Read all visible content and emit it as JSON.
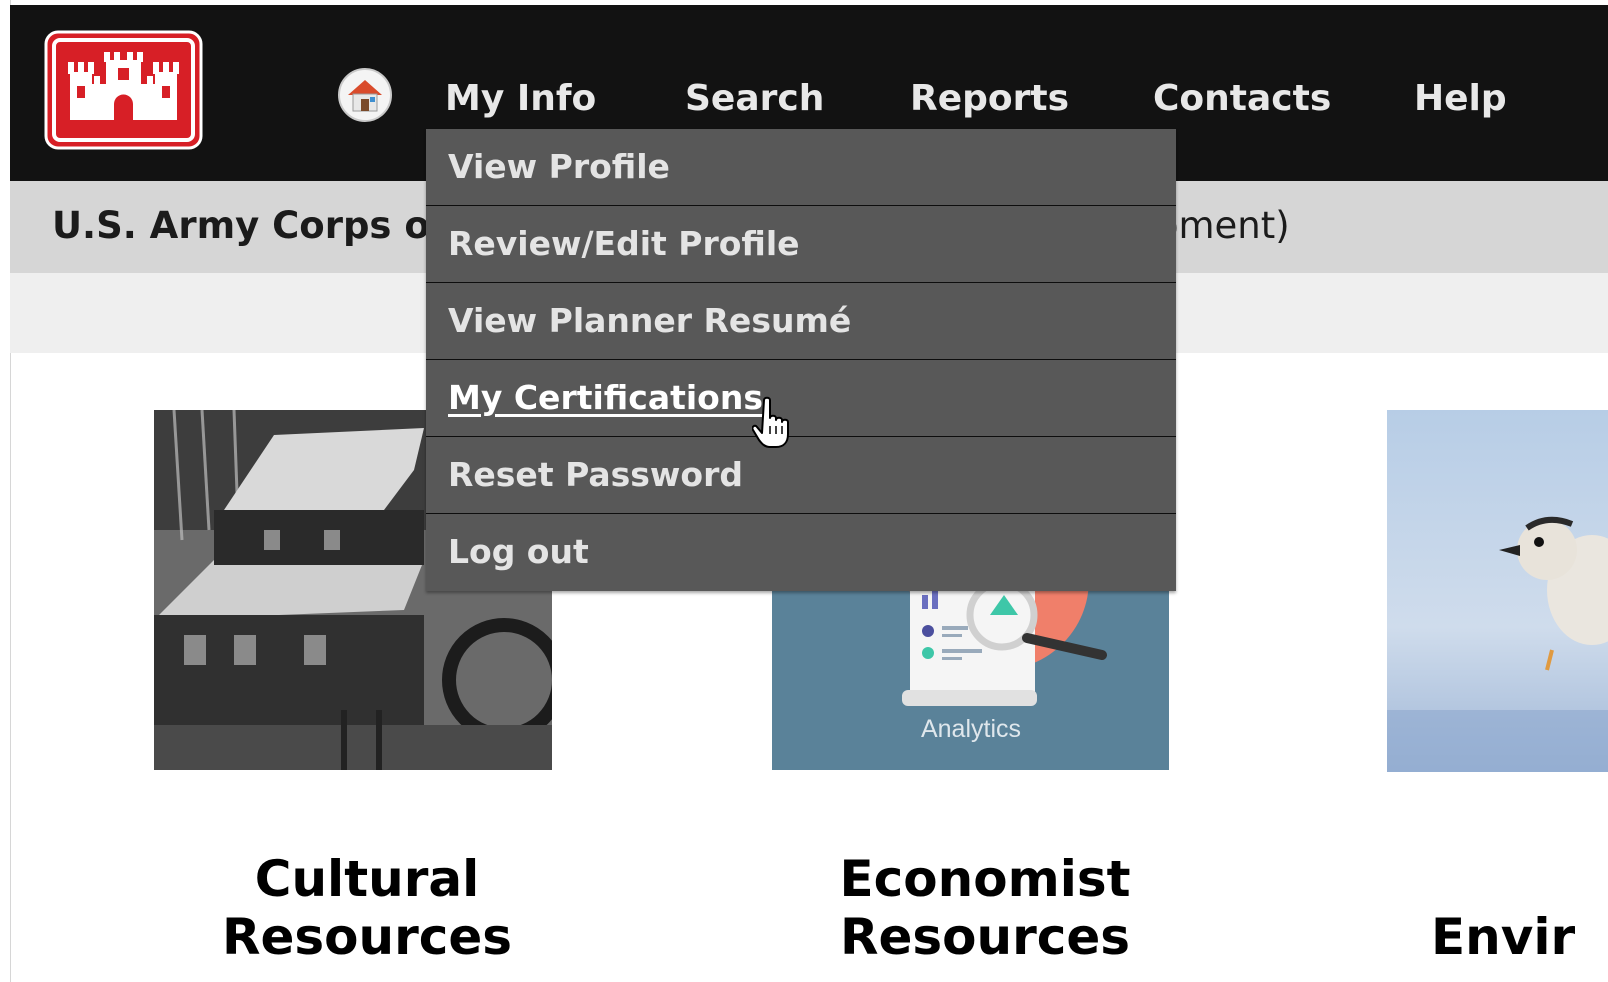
{
  "header": {
    "logo_name": "castle-logo",
    "home_icon": "home-icon",
    "nav": [
      {
        "label": "My Info"
      },
      {
        "label": "Search"
      },
      {
        "label": "Reports"
      },
      {
        "label": "Contacts"
      },
      {
        "label": "Help"
      }
    ]
  },
  "subheader": {
    "title_visible": "U.S. Army Corps o",
    "title_tail_visible": "pment)"
  },
  "dropdown": {
    "parent": "My Info",
    "items": [
      {
        "label": "View Profile"
      },
      {
        "label": "Review/Edit Profile"
      },
      {
        "label": "View Planner Resumé"
      },
      {
        "label": "My Certifications",
        "hovered": true
      },
      {
        "label": "Reset Password"
      },
      {
        "label": "Log out"
      }
    ]
  },
  "cards": [
    {
      "title_line1": "Cultural",
      "title_line2": "Resources"
    },
    {
      "title_line1": "Economist",
      "title_line2": "Resources",
      "image_caption": "Analytics"
    },
    {
      "title_line1": "Envir",
      "title_line2": ""
    }
  ],
  "colors": {
    "topbar": "#121212",
    "subbar": "#d6d6d6",
    "menu_bg": "#585858",
    "logo_red": "#d71f26"
  }
}
